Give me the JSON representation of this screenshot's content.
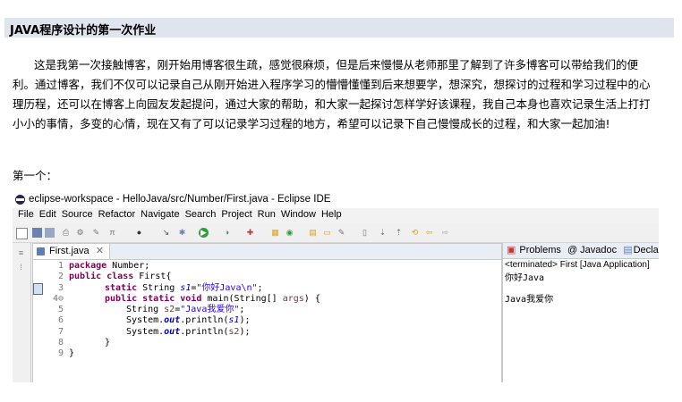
{
  "article": {
    "title": "JAVA程序设计的第一次作业",
    "paragraph": "这是我第一次接触博客，刚开始用博客很生疏，感觉很麻烦，但是后来慢慢从老师那里了解到了许多博客可以带给我们的便利。通过博客，我们不仅可以记录自己从刚开始进入程序学习的懵懵懂懂到后来想要学，想深究，想探讨的过程和学习过程中的心理历程，还可以在博客上向园友发起提问，通过大家的帮助，和大家一起探讨怎样学好该课程，我自己本身也喜欢记录生活上打打小小的事情，多变的心情，现在又有了可以记录学习过程的地方，希望可以记录下自己慢慢成长的过程，和大家一起加油!",
    "first_label": "第一个："
  },
  "ide": {
    "window_title": "eclipse-workspace - HelloJava/src/Number/First.java - Eclipse IDE",
    "menu": [
      "File",
      "Edit",
      "Source",
      "Refactor",
      "Navigate",
      "Search",
      "Project",
      "Run",
      "Window",
      "Help"
    ],
    "editor_tab": "First.java",
    "code": {
      "l1_a": "package",
      "l1_b": " Number;",
      "l2_a": "public class",
      "l2_b": " First{",
      "l3_a": "static",
      "l3_b": " String ",
      "l3_c": "s1",
      "l3_d": "=",
      "l3_e": "\"你好Java\\n\"",
      "l3_f": ";",
      "l4_a": "public static void",
      "l4_b": " main(String[] ",
      "l4_c": "args",
      "l4_d": ") {",
      "l5_a": "String ",
      "l5_b": "s2",
      "l5_c": "=",
      "l5_d": "\"Java我爱你\"",
      "l5_e": ";",
      "l6_a": "System.",
      "l6_b": "out",
      "l6_c": ".println(",
      "l6_d": "s1",
      "l6_e": ");",
      "l7_a": "System.",
      "l7_b": "out",
      "l7_c": ".println(",
      "l7_d": "s2",
      "l7_e": ");",
      "l8": "}",
      "l9": "}",
      "line_numbers": [
        "1",
        "2",
        "3",
        "4⊖",
        "5",
        "6",
        "7",
        "8",
        "9"
      ]
    },
    "console": {
      "tab_problems": "Problems",
      "tab_javadoc": "@ Javadoc",
      "tab_declaration": "Declaratio",
      "terminated": "<terminated> First [Java Application]",
      "output_line1": "你好Java",
      "output_line2": "",
      "output_line3": "Java我爱你"
    }
  }
}
